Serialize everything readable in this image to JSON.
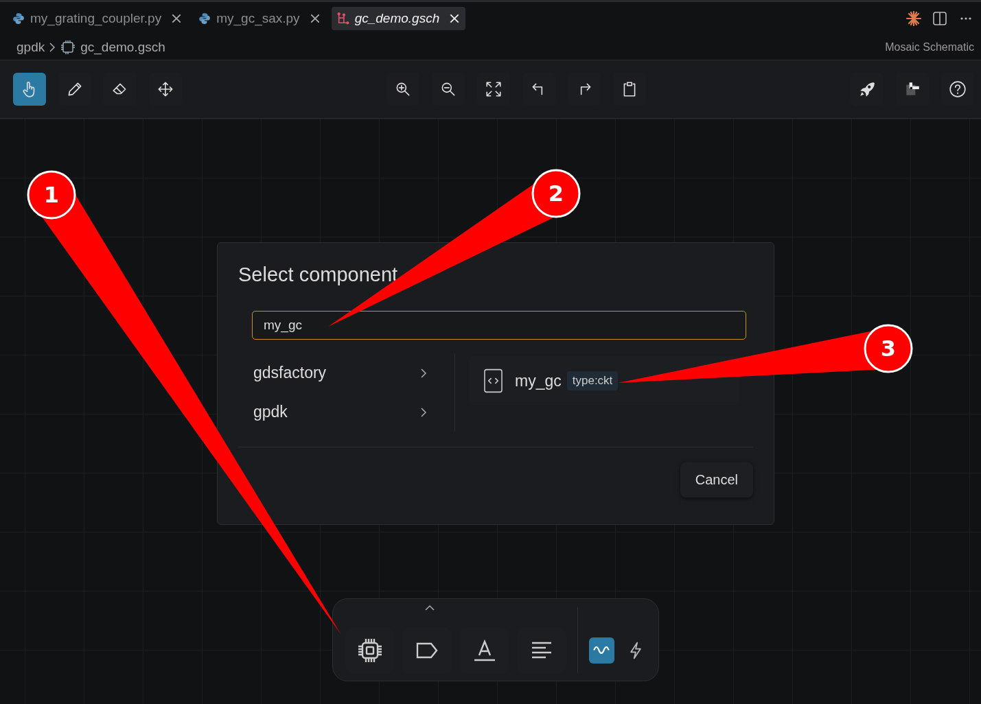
{
  "tabs": [
    {
      "label": "my_grating_coupler.py",
      "kind": "python",
      "selected": false,
      "preview": false
    },
    {
      "label": "my_gc_sax.py",
      "kind": "python",
      "selected": false,
      "preview": false
    },
    {
      "label": "gc_demo.gsch",
      "kind": "schematic",
      "selected": true,
      "preview": true
    }
  ],
  "breadcrumb": [
    "gpdk",
    "gc_demo.gsch"
  ],
  "editor_picker": "Mosaic Schematic",
  "toolbar": {
    "left": [
      {
        "kind": "hand",
        "selected": true
      },
      {
        "kind": "pencil",
        "selected": false
      },
      {
        "kind": "eraser",
        "selected": false
      },
      {
        "kind": "move",
        "selected": false
      }
    ],
    "center": [
      {
        "kind": "zoom-in"
      },
      {
        "kind": "zoom-out"
      },
      {
        "kind": "fit"
      },
      {
        "kind": "undo"
      },
      {
        "kind": "redo"
      },
      {
        "kind": "clipboard"
      }
    ],
    "right": [
      {
        "kind": "rocket"
      },
      {
        "kind": "block"
      },
      {
        "kind": "help"
      }
    ]
  },
  "dialog": {
    "title": "Select component",
    "search": {
      "value": "my_gc"
    },
    "libraries": [
      {
        "label": "gdsfactory"
      },
      {
        "label": "gpdk"
      }
    ],
    "results": [
      {
        "name": "my_gc",
        "tag": "type:ckt"
      }
    ],
    "cancel": "Cancel"
  },
  "palette": {
    "items": [
      {
        "kind": "chip"
      },
      {
        "kind": "label"
      },
      {
        "kind": "text"
      },
      {
        "kind": "lines"
      }
    ],
    "modes": [
      {
        "kind": "wave",
        "selected": true
      },
      {
        "kind": "bolt",
        "selected": false
      }
    ]
  },
  "callouts": [
    {
      "number": "1"
    },
    {
      "number": "2"
    },
    {
      "number": "3"
    }
  ]
}
